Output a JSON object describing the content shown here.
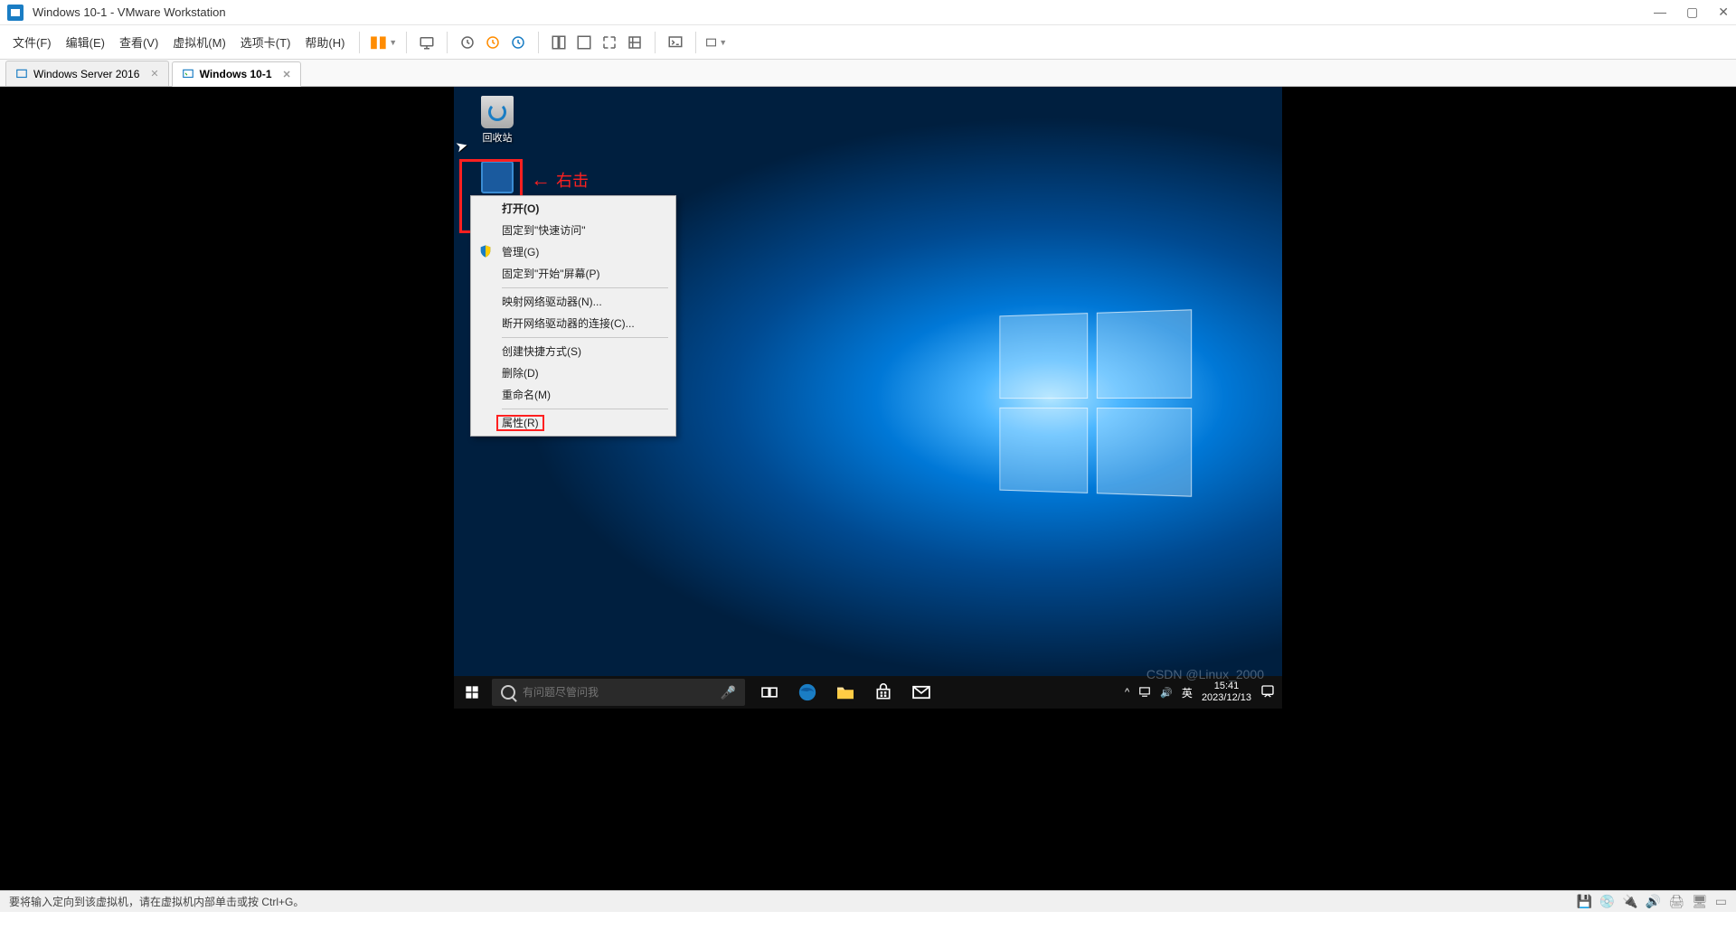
{
  "host": {
    "title": "Windows 10-1 - VMware Workstation",
    "statusbar": "要将输入定向到该虚拟机，请在虚拟机内部单击或按 Ctrl+G。"
  },
  "menubar": {
    "items": [
      "文件(F)",
      "编辑(E)",
      "查看(V)",
      "虚拟机(M)",
      "选项卡(T)",
      "帮助(H)"
    ]
  },
  "tabs": [
    {
      "label": "Windows Server 2016",
      "active": false
    },
    {
      "label": "Windows 10-1",
      "active": true
    }
  ],
  "desktop": {
    "recyclebin_label": "回收站",
    "annotation_label": "右击",
    "search_placeholder": "有问题尽管问我",
    "clock_time": "15:41",
    "clock_date": "2023/12/13",
    "lang": "英",
    "tray_caret": "^"
  },
  "context_menu": {
    "open": "打开(O)",
    "pin_quick": "固定到\"快速访问\"",
    "manage": "管理(G)",
    "pin_start": "固定到\"开始\"屏幕(P)",
    "map_drive": "映射网络驱动器(N)...",
    "disconnect_drive": "断开网络驱动器的连接(C)...",
    "create_shortcut": "创建快捷方式(S)",
    "delete": "删除(D)",
    "rename": "重命名(M)",
    "properties": "属性(R)"
  },
  "watermark": "CSDN @Linux_2000"
}
